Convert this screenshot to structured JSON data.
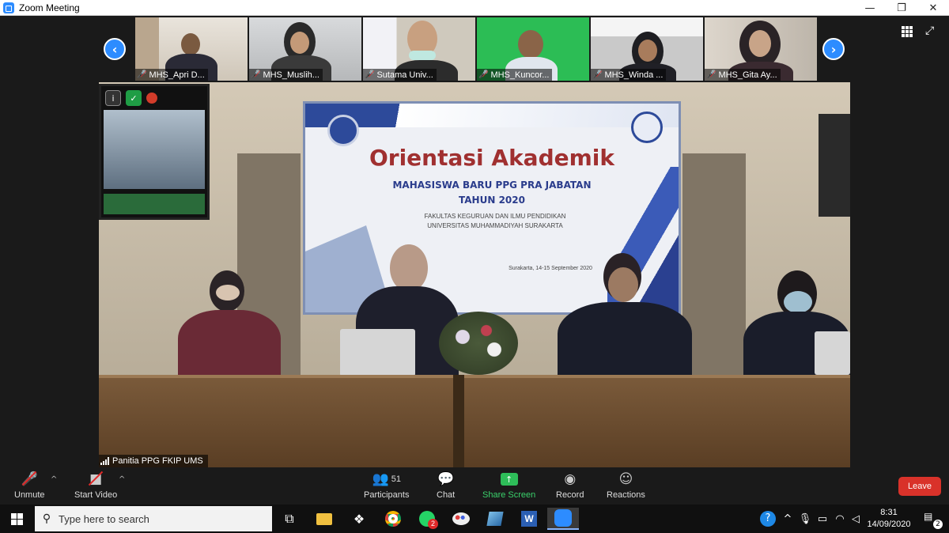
{
  "window": {
    "title": "Zoom Meeting",
    "minimize": "—",
    "maximize": "❐",
    "close": "✕"
  },
  "gallery": {
    "participants": [
      {
        "name": "MHS_Apri D..."
      },
      {
        "name": "MHS_Muslih..."
      },
      {
        "name": "Sutama Univ..."
      },
      {
        "name": "MHS_Kuncor..."
      },
      {
        "name": "MHS_Winda ..."
      },
      {
        "name": "MHS_Gita Ay..."
      }
    ],
    "prev_icon": "chevron-left-icon",
    "next_icon": "chevron-right-icon"
  },
  "main_video": {
    "label": "Panitia PPG FKIP UMS",
    "banner": {
      "title": "Orientasi Akademik",
      "line2": "MAHASISWA BARU PPG PRA JABATAN",
      "line3": "TAHUN 2020",
      "line4": "FAKULTAS KEGURUAN DAN ILMU PENDIDIKAN",
      "line5": "UNIVERSITAS MUHAMMADIYAH SURAKARTA",
      "line6": "Surakarta, 14-15 September 2020"
    }
  },
  "toolbar": {
    "unmute": "Unmute",
    "start_video": "Start Video",
    "participants": "Participants",
    "participants_count": "51",
    "chat": "Chat",
    "share_screen": "Share Screen",
    "record": "Record",
    "reactions": "Reactions",
    "leave": "Leave"
  },
  "taskbar": {
    "search_placeholder": "Type here to search",
    "time": "8:31",
    "date": "14/09/2020",
    "notification_count": "2",
    "whatsapp_badge": "2"
  },
  "colors": {
    "accent": "#2d8cff",
    "leave": "#d9322a",
    "share": "#2ebd59",
    "muted": "#e02828"
  }
}
